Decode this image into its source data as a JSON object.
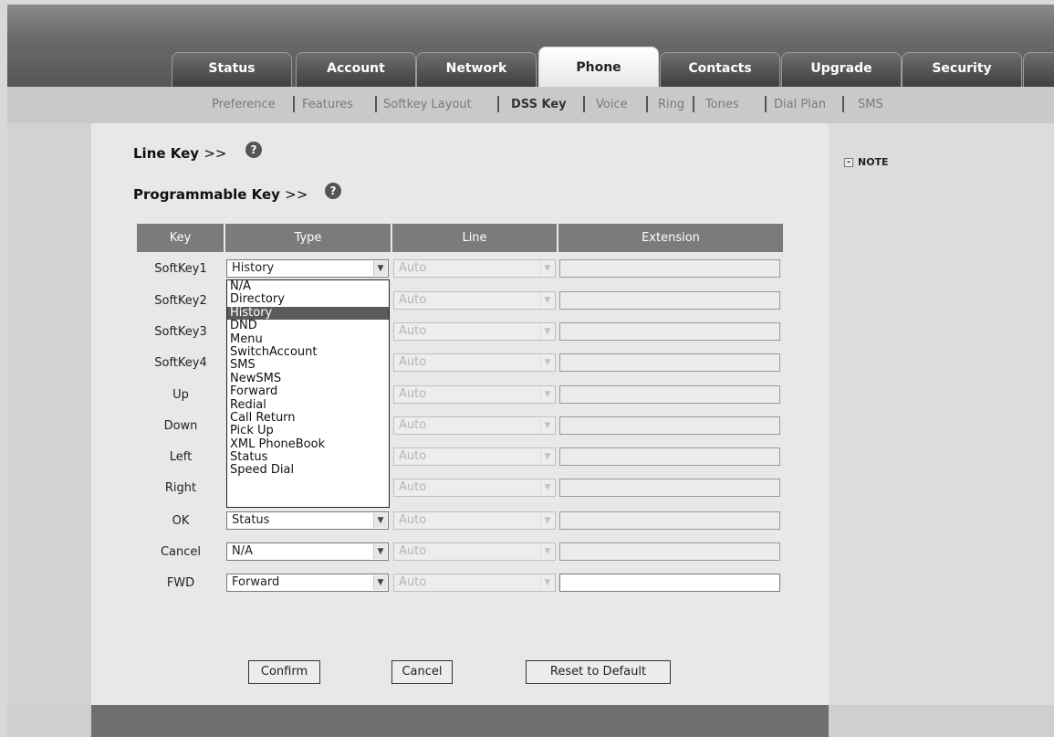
{
  "tabs": [
    {
      "label": "Status"
    },
    {
      "label": "Account"
    },
    {
      "label": "Network"
    },
    {
      "label": "Phone"
    },
    {
      "label": "Contacts"
    },
    {
      "label": "Upgrade"
    },
    {
      "label": "Security"
    }
  ],
  "subnav": [
    {
      "label": "Preference"
    },
    {
      "label": "Features"
    },
    {
      "label": "Softkey Layout"
    },
    {
      "label": "DSS Key"
    },
    {
      "label": "Voice"
    },
    {
      "label": "Ring"
    },
    {
      "label": "Tones"
    },
    {
      "label": "Dial Plan"
    },
    {
      "label": "SMS"
    }
  ],
  "sections": {
    "line_key": {
      "label": "Line Key",
      "arrows": ">>"
    },
    "programmable_key": {
      "label": "Programmable Key",
      "arrows": ">>"
    },
    "help_glyph": "?"
  },
  "note": {
    "label": "NOTE",
    "toggle": "-"
  },
  "table": {
    "headers": {
      "key": "Key",
      "type": "Type",
      "line": "Line",
      "extension": "Extension"
    },
    "rows": [
      {
        "key": "SoftKey1",
        "type": "History",
        "line": "Auto"
      },
      {
        "key": "SoftKey2",
        "type": "",
        "line": "Auto"
      },
      {
        "key": "SoftKey3",
        "type": "",
        "line": "Auto"
      },
      {
        "key": "SoftKey4",
        "type": "",
        "line": "Auto"
      },
      {
        "key": "Up",
        "type": "",
        "line": "Auto"
      },
      {
        "key": "Down",
        "type": "",
        "line": "Auto"
      },
      {
        "key": "Left",
        "type": "",
        "line": "Auto"
      },
      {
        "key": "Right",
        "type": "",
        "line": "Auto"
      },
      {
        "key": "OK",
        "type": "Status",
        "line": "Auto"
      },
      {
        "key": "Cancel",
        "type": "N/A",
        "line": "Auto"
      },
      {
        "key": "FWD",
        "type": "Forward",
        "line": "Auto"
      }
    ]
  },
  "dropdown": {
    "selected": "History",
    "options": [
      "N/A",
      "Directory",
      "History",
      "DND",
      "Menu",
      "SwitchAccount",
      "SMS",
      "NewSMS",
      "Forward",
      "Redial",
      "Call Return",
      "Pick Up",
      "XML PhoneBook",
      "Status",
      "Speed Dial"
    ]
  },
  "buttons": {
    "confirm": "Confirm",
    "cancel": "Cancel",
    "reset": "Reset to Default"
  },
  "icons": {
    "select_arrow": "chevron-down-icon",
    "help": "question-circle-icon",
    "note_toggle": "collapse-box-icon"
  }
}
